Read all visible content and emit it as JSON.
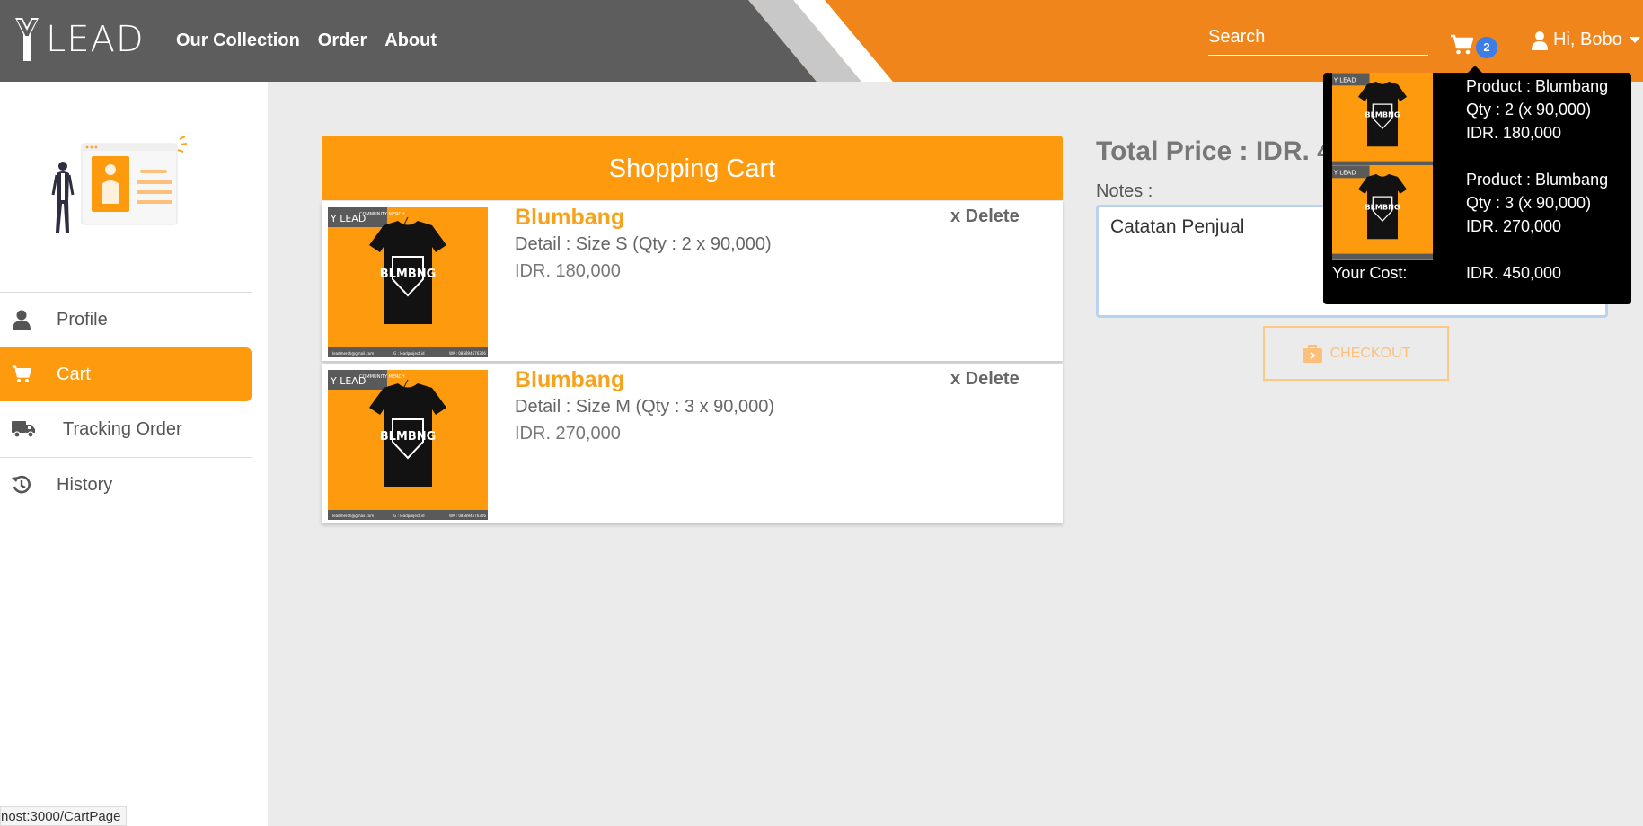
{
  "brand": {
    "logo_text": "LEAD"
  },
  "nav": {
    "links": [
      "Our Collection",
      "Order",
      "About"
    ],
    "search_placeholder": "Search",
    "cart_count": "2",
    "user_greeting": "Hi, Bobo"
  },
  "sidebar": {
    "items": [
      {
        "label": "Profile",
        "icon": "user-icon"
      },
      {
        "label": "Cart",
        "icon": "cart-icon",
        "active": true
      },
      {
        "label": "Tracking Order",
        "icon": "truck-icon"
      },
      {
        "label": "History",
        "icon": "history-icon"
      }
    ]
  },
  "status_bar": {
    "url": "nost:3000/CartPage"
  },
  "cart": {
    "title": "Shopping Cart",
    "items": [
      {
        "name": "Blumbang",
        "detail": "Detail : Size S (Qty : 2 x 90,000)",
        "price": "IDR. 180,000",
        "delete_label": "x Delete"
      },
      {
        "name": "Blumbang",
        "detail": "Detail : Size M (Qty : 3 x 90,000)",
        "price": "IDR. 270,000",
        "delete_label": "x Delete"
      }
    ],
    "total_label": "Total Price : IDR. 450,000",
    "notes_label": "Notes :",
    "notes_value": "Catatan Penjual",
    "checkout_label": "CHECKOUT"
  },
  "product_image": {
    "badge": "COMMUNITY MERCH",
    "shirt_text": "BLMBNG",
    "footer": [
      "leadmerch@gmail.com",
      "IG : leadproject.id",
      "WA : 085894676306"
    ]
  },
  "popover": {
    "items": [
      {
        "product": "Product : Blumbang",
        "qty": "Qty : 2 (x 90,000)",
        "price": "IDR. 180,000"
      },
      {
        "product": "Product : Blumbang",
        "qty": "Qty : 3 (x 90,000)",
        "price": "IDR. 270,000"
      }
    ],
    "cost_label": "Your Cost:",
    "cost_value": "IDR. 450,000"
  },
  "colors": {
    "accent": "#fe9a0d",
    "nav_orange": "#f0861b",
    "nav_grey": "#5e5d5d",
    "badge_blue": "#3c7de8"
  }
}
